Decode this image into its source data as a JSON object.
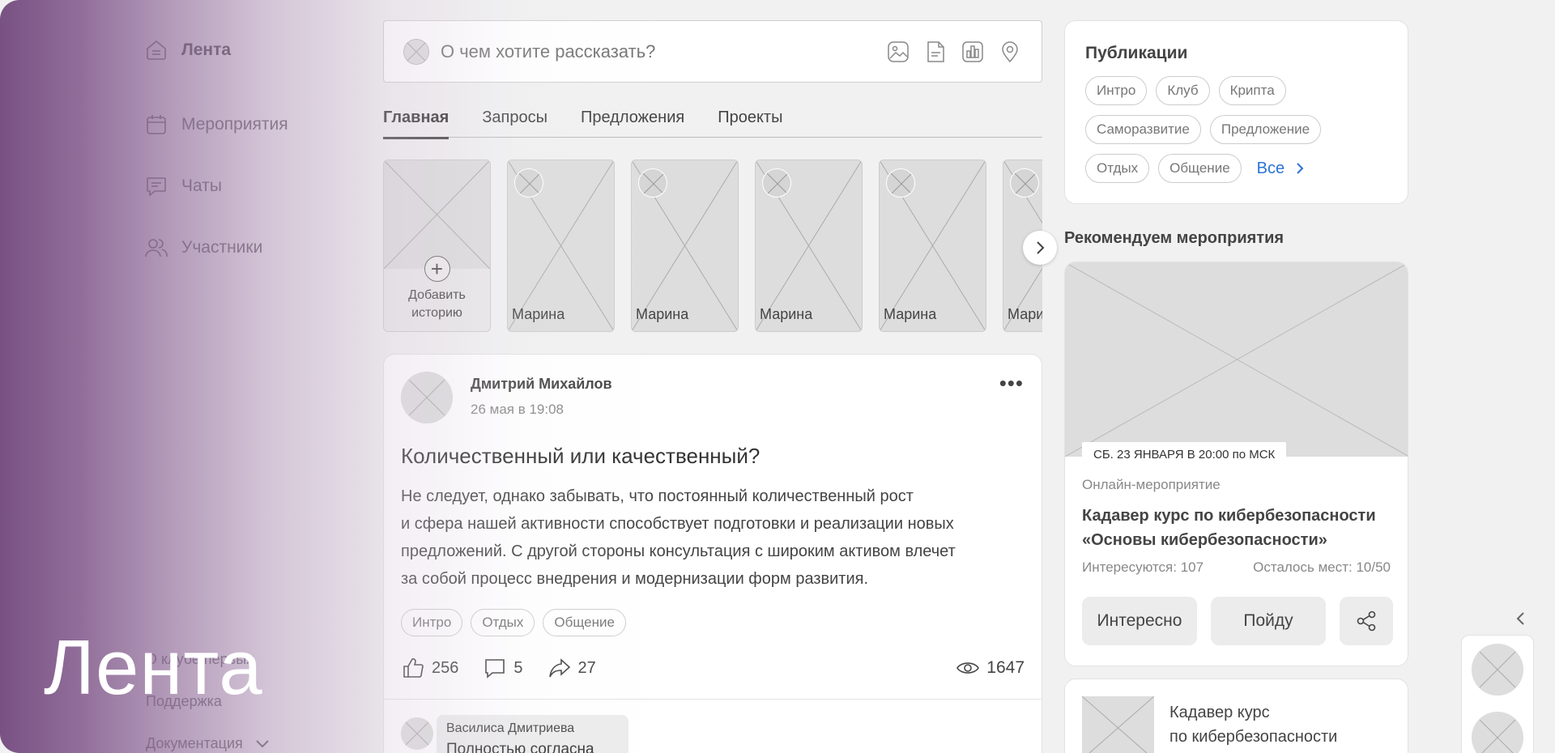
{
  "hero": {
    "title": "Лента"
  },
  "sidebar": {
    "items": [
      {
        "label": "Лента",
        "icon": "home-icon",
        "active": true
      },
      {
        "label": "Мероприятия",
        "icon": "calendar-icon"
      },
      {
        "label": "Чаты",
        "icon": "chat-icon"
      },
      {
        "label": "Участники",
        "icon": "users-icon"
      }
    ],
    "bottom_links": {
      "about": "О клубе первых",
      "support": "Поддержка",
      "docs": "Документация"
    }
  },
  "composer": {
    "placeholder": "О чем хотите рассказать?",
    "tools": [
      "image-icon",
      "document-icon",
      "poll-icon",
      "location-icon"
    ]
  },
  "tabs": [
    "Главная",
    "Запросы",
    "Предложения",
    "Проекты"
  ],
  "stories": {
    "add_label_line1": "Добавить",
    "add_label_line2": "историю",
    "items": [
      "Марина",
      "Марина",
      "Марина",
      "Марина",
      "Марина"
    ]
  },
  "post": {
    "author": "Дмитрий Михайлов",
    "date": "26 мая в 19:08",
    "more": "•••",
    "title": "Количественный или качественный?",
    "body_lines": [
      "Не следует, однако забывать, что постоянный количественный рост",
      "и сфера нашей активности способствует подготовки и реализации новых",
      "предложений. С другой стороны консультация с широким активом влечет",
      "за собой процесс внедрения и модернизации форм развития."
    ],
    "tags": [
      "Интро",
      "Отдых",
      "Общение"
    ],
    "likes": "256",
    "comments": "5",
    "shares": "27",
    "views": "1647",
    "comment": {
      "author": "Василиса Дмитриева",
      "text": "Полностью согласна"
    }
  },
  "publications": {
    "title": "Публикации",
    "chips": [
      "Интро",
      "Клуб",
      "Крипта",
      "Саморазвитие",
      "Предложение",
      "Отдых",
      "Общение"
    ],
    "all_label": "Все"
  },
  "recommended": {
    "title": "Рекомендуем мероприятия",
    "event": {
      "date": "СБ. 23 ЯНВАРЯ В 20:00 по МСК",
      "type": "Онлайн-мероприятие",
      "name_line1": "Кадавер курс по кибербезопасности",
      "name_line2": "«Основы кибербезопасности»",
      "interested": "Интересуются: 107",
      "seats": "Осталось мест: 10/50",
      "btn_interested": "Интересно",
      "btn_go": "Пойду"
    },
    "event2": {
      "title_line1": "Кадавер курс",
      "title_line2": "по кибербезопасности"
    }
  }
}
